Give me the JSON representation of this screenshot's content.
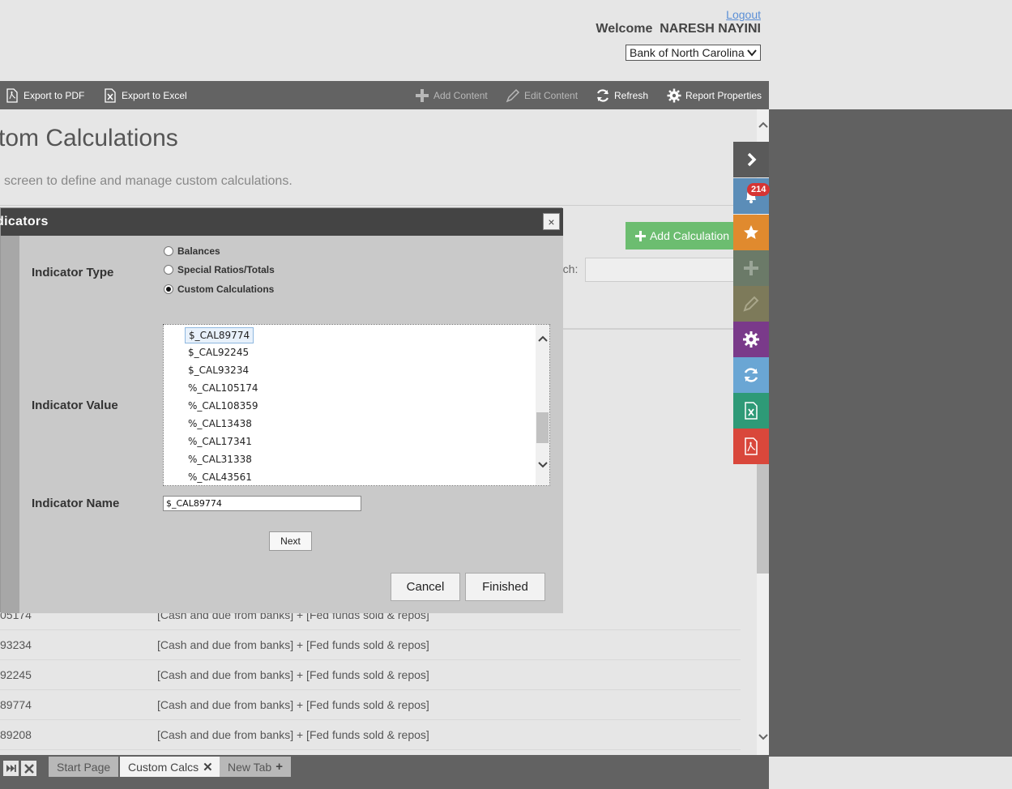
{
  "header": {
    "logout": "Logout",
    "welcome_label": "Welcome",
    "user_name": "NARESH NAYINI",
    "bank_selected": "Bank of North Carolina"
  },
  "toolbar": {
    "export_pdf": "Export to PDF",
    "export_excel": "Export to Excel",
    "add_content": "Add Content",
    "edit_content": "Edit Content",
    "refresh": "Refresh",
    "report_properties": "Report Properties"
  },
  "page": {
    "title": "tom Calculations",
    "description": "screen to define and manage custom calculations.",
    "add_calculation": "Add Calculation",
    "search_label": "rch:"
  },
  "table": {
    "rows": [
      {
        "id": "05174",
        "formula": "[Cash and due from banks] + [Fed funds sold & repos]"
      },
      {
        "id": "93234",
        "formula": "[Cash and due from banks] + [Fed funds sold & repos]"
      },
      {
        "id": "92245",
        "formula": "[Cash and due from banks] + [Fed funds sold & repos]"
      },
      {
        "id": "89774",
        "formula": "[Cash and due from banks] + [Fed funds sold & repos]"
      },
      {
        "id": "89208",
        "formula": "[Cash and due from banks] + [Fed funds sold & repos]"
      }
    ]
  },
  "sidebar": {
    "notification_count": "214",
    "icons": [
      "chevron-right-icon",
      "bell-icon",
      "star-icon",
      "plus-icon",
      "pencil-icon",
      "gear-icon",
      "refresh-icon",
      "excel-icon",
      "pdf-icon"
    ],
    "colors": {
      "collapse": "#5a5a5a",
      "notifications": "#5b8db8",
      "favorites": "#e08a2e",
      "add": "#6b7a68",
      "edit": "#7d7a5a",
      "settings": "#7a3a8a",
      "refresh": "#6aa6d4",
      "excel": "#2e9a77",
      "pdf": "#d9473b"
    }
  },
  "dialog": {
    "title": "dicators",
    "close": "×",
    "indicator_type_label": "Indicator Type",
    "radio_options": [
      {
        "label": "Balances",
        "selected": false
      },
      {
        "label": "Special Ratios/Totals",
        "selected": false
      },
      {
        "label": "Custom Calculations",
        "selected": true
      }
    ],
    "indicator_value_label": "Indicator Value",
    "values": [
      "$_CAL89774",
      "$_CAL92245",
      "$_CAL93234",
      "%_CAL105174",
      "%_CAL108359",
      "%_CAL13438",
      "%_CAL17341",
      "%_CAL31338",
      "%_CAL43561"
    ],
    "selected_value": "$_CAL89774",
    "indicator_name_label": "Indicator Name",
    "indicator_name_value": "$_CAL89774",
    "next": "Next",
    "cancel": "Cancel",
    "finished": "Finished"
  },
  "tabs": {
    "items": [
      {
        "label": "Start Page",
        "active": false
      },
      {
        "label": "Custom Calcs",
        "active": true
      },
      {
        "label": "New Tab",
        "active": false
      }
    ]
  }
}
